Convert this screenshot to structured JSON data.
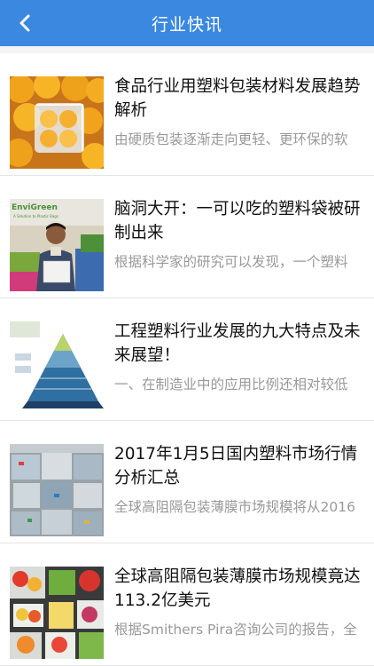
{
  "header": {
    "title": "行业快讯",
    "back_icon": "chevron-left-icon"
  },
  "colors": {
    "header_bg": "#3b88e0",
    "title_text": "#111111",
    "summary_text": "#999999"
  },
  "articles": [
    {
      "title": "食品行业用塑料包装材料发展趋势解析",
      "summary": "由硬质包装逐渐走向更轻、更环保的软",
      "thumb": "oranges"
    },
    {
      "title": "脑洞大开：一可以吃的塑料袋被研制出来",
      "summary": "根据科学家的研究可以发现，一个塑料",
      "thumb": "envigreen",
      "thumb_logo_text": "EnviGreen",
      "thumb_logo_tagline": "A Solution to Plastic Bags"
    },
    {
      "title": "工程塑料行业发展的九大特点及未来展望！",
      "summary": "一、在制造业中的应用比例还相对较低",
      "thumb": "pyramid"
    },
    {
      "title": "2017年1月5日国内塑料市场行情分析汇总",
      "summary": "全球高阻隔包装薄膜市场规模将从2016",
      "thumb": "bales"
    },
    {
      "title": "全球高阻隔包装薄膜市场规模竟达113.2亿美元",
      "summary": "根据Smithers Pira咨询公司的报告，全",
      "thumb": "produce"
    }
  ]
}
